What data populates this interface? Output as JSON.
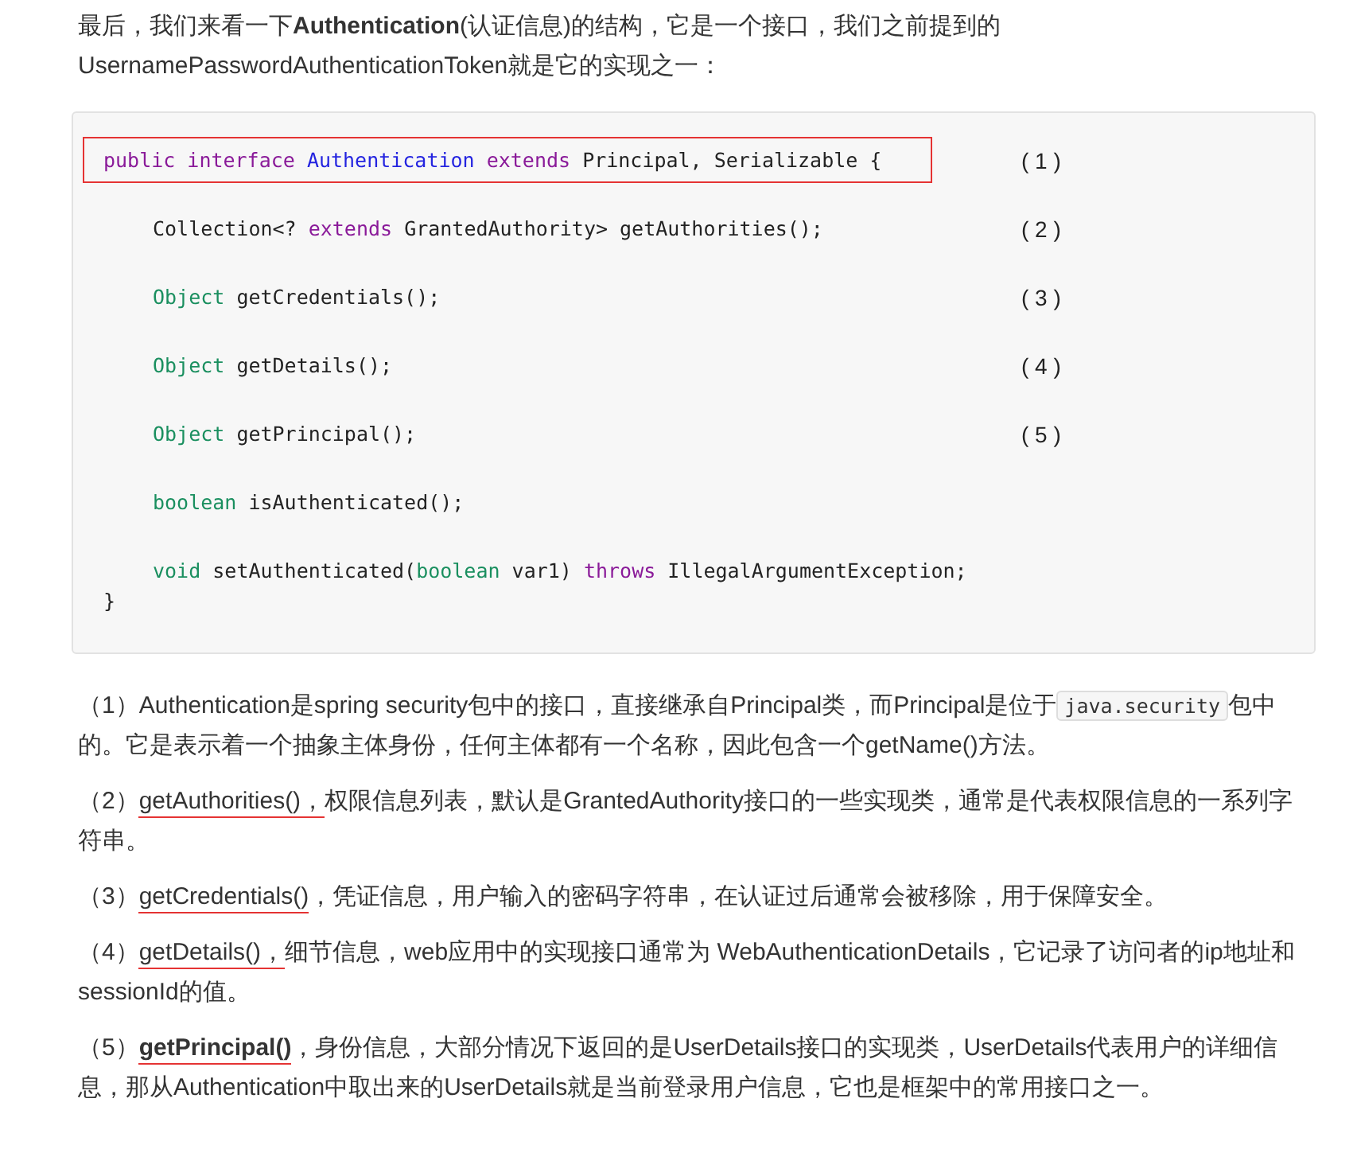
{
  "intro": "最后，我们来看一下**Authentication**(认证信息)的结构，它是一个接口，我们之前提到的UsernamePasswordAuthenticationToken就是它的实现之一：",
  "code_lines": [
    {
      "indent": false,
      "highlighted": true,
      "marker": "( 1 )",
      "tokens": [
        {
          "kind": "keyword",
          "text": "public interface"
        },
        {
          "kind": "name",
          "text": "Authentication"
        },
        {
          "kind": "keyword",
          "text": "extends"
        },
        {
          "kind": "plain",
          "text": "Principal, Serializable {"
        }
      ]
    },
    {
      "indent": true,
      "highlighted": false,
      "marker": "( 2 )",
      "tokens": [
        {
          "kind": "plain",
          "text": "Collection<?"
        },
        {
          "kind": "keyword",
          "text": "extends"
        },
        {
          "kind": "plain",
          "text": "GrantedAuthority> getAuthorities();"
        }
      ]
    },
    {
      "indent": true,
      "highlighted": false,
      "marker": "( 3 )",
      "tokens": [
        {
          "kind": "type",
          "text": "Object"
        },
        {
          "kind": "plain",
          "text": "getCredentials();"
        }
      ]
    },
    {
      "indent": true,
      "highlighted": false,
      "marker": "( 4 )",
      "tokens": [
        {
          "kind": "type",
          "text": "Object"
        },
        {
          "kind": "plain",
          "text": "getDetails();"
        }
      ]
    },
    {
      "indent": true,
      "highlighted": false,
      "marker": "( 5 )",
      "tokens": [
        {
          "kind": "type",
          "text": "Object"
        },
        {
          "kind": "plain",
          "text": "getPrincipal();"
        }
      ]
    },
    {
      "indent": true,
      "highlighted": false,
      "tokens": [
        {
          "kind": "type",
          "text": "boolean"
        },
        {
          "kind": "plain",
          "text": "isAuthenticated();"
        }
      ]
    },
    {
      "indent": true,
      "highlighted": false,
      "tokens": [
        {
          "kind": "type",
          "text": "void"
        },
        {
          "kind": "plain",
          "text": "setAuthenticated("
        },
        {
          "kind": "type",
          "text": "boolean"
        },
        {
          "kind": "plain",
          "text": "var1)"
        },
        {
          "kind": "keyword",
          "text": "throws"
        },
        {
          "kind": "plain",
          "text": "IllegalArgumentException;"
        }
      ]
    },
    {
      "indent": false,
      "highlighted": false,
      "tokens": [
        {
          "kind": "plain",
          "text": "}"
        }
      ]
    }
  ],
  "notes": [
    {
      "segments": [
        {
          "kind": "text",
          "text": "（1）Authentication是spring security包中的接口，直接继承自Principal类，而Principal是位于"
        },
        {
          "kind": "code",
          "text": "java.security"
        },
        {
          "kind": "text",
          "text": "包中的。它是表示着一个抽象主体身份，任何主体都有一个名称，因此包含一个getName()方法。"
        }
      ]
    },
    {
      "segments": [
        {
          "kind": "text",
          "text": "（2）"
        },
        {
          "kind": "underlined",
          "text": "getAuthorities()，"
        },
        {
          "kind": "text",
          "text": "权限信息列表，默认是GrantedAuthority接口的一些实现类，通常是代表权限信息的一系列字符串。"
        }
      ]
    },
    {
      "segments": [
        {
          "kind": "text",
          "text": "（3）"
        },
        {
          "kind": "underlined",
          "text": "getCredentials()"
        },
        {
          "kind": "text",
          "text": "，凭证信息，用户输入的密码字符串，在认证过后通常会被移除，用于保障安全。"
        }
      ]
    },
    {
      "segments": [
        {
          "kind": "text",
          "text": "（4）"
        },
        {
          "kind": "underlined",
          "text": "getDetails()，"
        },
        {
          "kind": "text",
          "text": "细节信息，web应用中的实现接口通常为 WebAuthenticationDetails，它记录了访问者的ip地址和sessionId的值。"
        }
      ]
    },
    {
      "segments": [
        {
          "kind": "text",
          "text": "（5）"
        },
        {
          "kind": "underlined",
          "text": "**getPrincipal()**"
        },
        {
          "kind": "text",
          "text": "，身份信息，大部分情况下返回的是UserDetails接口的实现类，UserDetails代表用户的详细信息，那从Authentication中取出来的UserDetails就是当前登录用户信息，它也是框架中的常用接口之一。"
        }
      ]
    }
  ]
}
